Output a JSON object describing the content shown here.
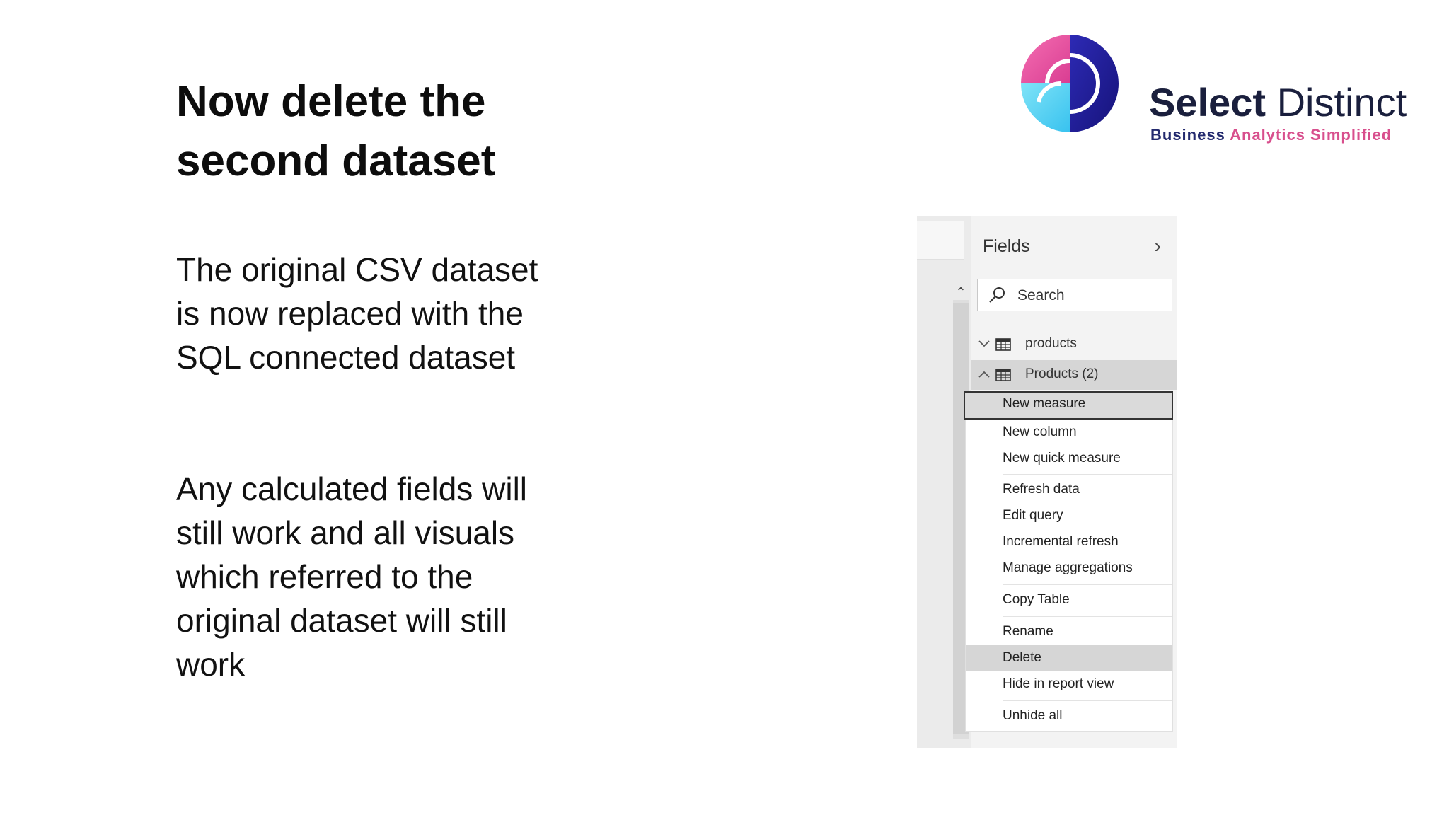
{
  "slide": {
    "title_line1": "Now delete the",
    "title_line2": "second dataset",
    "para1_lines": [
      "The original CSV dataset",
      "is now replaced with the",
      "SQL connected dataset"
    ],
    "para2_lines": [
      "Any calculated fields will",
      "still work and all visuals",
      "which referred to the",
      "original dataset will still",
      "work"
    ]
  },
  "brand": {
    "name_part1": "Select",
    "name_part2": "Distinct",
    "tagline_part1": "Business",
    "tagline_part2": "Analytics Simplified",
    "colors": {
      "navy": "#1a1f3d",
      "pink": "#e8489a",
      "blue": "#1f1d9a",
      "cyan": "#5ad7f5"
    }
  },
  "fields_pane": {
    "title": "Fields",
    "collapse_icon": "chevron-right-icon",
    "search_placeholder": "Search",
    "tables": [
      {
        "label": "products",
        "state": "collapsed",
        "icon": "table-icon"
      },
      {
        "label": "Products (2)",
        "state": "expanded",
        "icon": "table-icon",
        "selected": true
      }
    ]
  },
  "context_menu": {
    "groups": [
      [
        {
          "label": "New measure",
          "state": "focused"
        },
        {
          "label": "New column"
        },
        {
          "label": "New quick measure"
        }
      ],
      [
        {
          "label": "Refresh data"
        },
        {
          "label": "Edit query"
        },
        {
          "label": "Incremental refresh"
        },
        {
          "label": "Manage aggregations"
        }
      ],
      [
        {
          "label": "Copy Table"
        }
      ],
      [
        {
          "label": "Rename"
        },
        {
          "label": "Delete",
          "state": "hover"
        },
        {
          "label": "Hide in report view"
        }
      ],
      [
        {
          "label": "Unhide all"
        }
      ]
    ]
  }
}
